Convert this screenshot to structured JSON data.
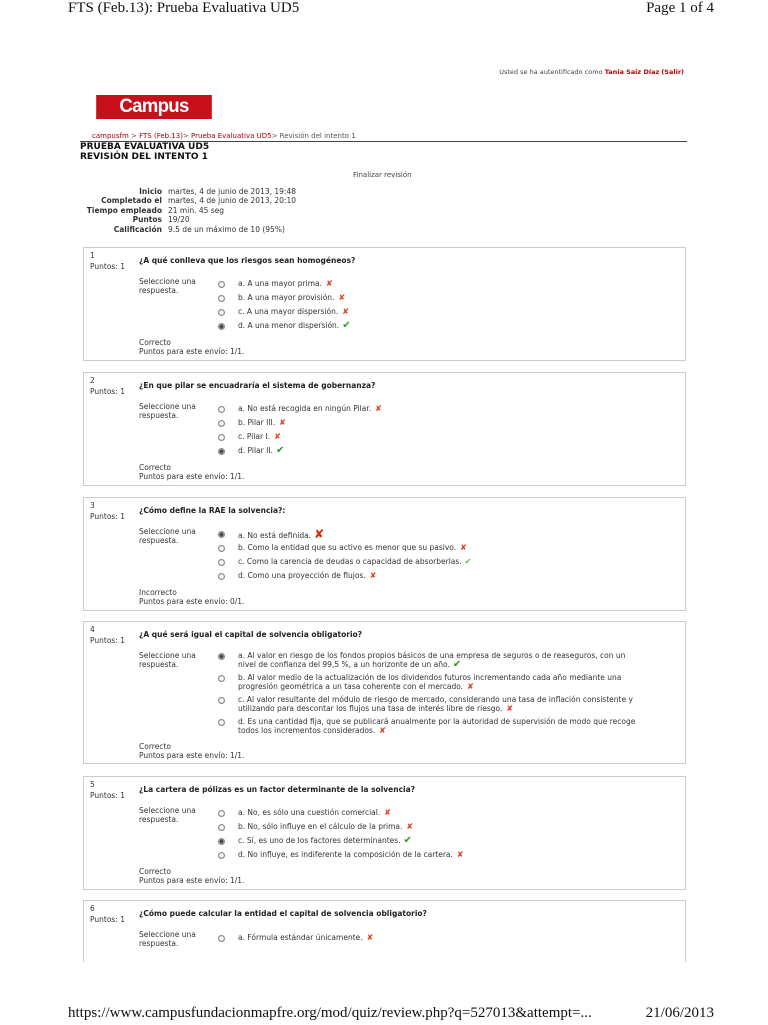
{
  "print": {
    "title": "FTS (Feb.13): Prueba Evaluativa UD5",
    "page": "Page 1 of 4",
    "url": "https://www.campusfundacionmapfre.org/mod/quiz/review.php?q=527013&attempt=...",
    "date": "21/06/2013"
  },
  "auth": {
    "prefix": "Usted se ha autentificado como",
    "user": "Tania Saiz Díaz",
    "logout": "(Salir)"
  },
  "logo": "Campus virtual",
  "breadcrumb": {
    "home": "campusfm",
    "course": "FTS (Feb.13)",
    "quiz": "Prueba Evaluativa UD5",
    "current": "Revisión del intento 1"
  },
  "header": {
    "title": "PRUEBA EVALUATIVA UD5",
    "subtitle": "REVISIÓN DEL INTENTO 1",
    "finish": "Finalizar revisión"
  },
  "summary": [
    {
      "k": "Inicio",
      "v": "martes, 4 de junio de 2013, 19:48"
    },
    {
      "k": "Completado el",
      "v": "martes, 4 de junio de 2013, 20:10"
    },
    {
      "k": "Tiempo empleado",
      "v": "21 min. 45 seg"
    },
    {
      "k": "Puntos",
      "v": "19/20"
    },
    {
      "k": "Calificación",
      "v": "9.5 de un máximo de 10 (95%)"
    }
  ],
  "questions": [
    {
      "num": "1",
      "pts": "Puntos: 1",
      "text": "¿A qué conlleva que los riesgos sean homogéneos?",
      "prompt": "Seleccione una respuesta.",
      "answers": [
        "a. A una mayor prima.",
        "b. A una mayor provisión.",
        "c. A una mayor dispersión.",
        "d. A una menor dispersión."
      ],
      "status": "Correcto",
      "score": "Puntos para este envío: 1/1."
    },
    {
      "num": "2",
      "pts": "Puntos: 1",
      "text": "¿En que pilar se encuadraría el sistema de gobernanza?",
      "prompt": "Seleccione una respuesta.",
      "answers": [
        "a. No está recogida en ningún Pilar.",
        "b. Pilar III.",
        "c. Pilar I.",
        "d. Pilar II."
      ],
      "status": "Correcto",
      "score": "Puntos para este envío: 1/1."
    },
    {
      "num": "3",
      "pts": "Puntos: 1",
      "text": "¿Cómo define la RAE la solvencia?:",
      "prompt": "Seleccione una respuesta.",
      "answers": [
        "a. No está definida.",
        "b. Como la entidad que su activo es menor que su pasivo.",
        "c. Como la carencia de deudas o capacidad de absorberlas.",
        "d. Como una proyección de flujos."
      ],
      "status": "Incorrecto",
      "score": "Puntos para este envío: 0/1."
    },
    {
      "num": "4",
      "pts": "Puntos: 1",
      "text": "¿A qué será igual el capital de solvencia obligatorio?",
      "prompt": "Seleccione una respuesta.",
      "answers": [
        "a. Al valor en riesgo de los fondos propios básicos de una empresa de seguros o de reaseguros, con un nivel de confianza del 99,5 %, a un horizonte de un año.",
        "b. Al valor medio de la actualización de los dividendos futuros incrementando cada año mediante una progresión geométrica a un tasa coherente con el mercado.",
        "c. Al valor resultante del módulo de riesgo de mercado, considerando una tasa de inflación consistente y utilizando para descontar los flujos una tasa de interés libre de riesgo.",
        "d. Es una cantidad fija, que se publicará anualmente por la autoridad de supervisión de modo que recoge todos los incrementos considerados."
      ],
      "status": "Correcto",
      "score": "Puntos para este envío: 1/1."
    },
    {
      "num": "5",
      "pts": "Puntos: 1",
      "text": "¿La cartera de pólizas es un factor determinante de la solvencia?",
      "prompt": "Seleccione una respuesta.",
      "answers": [
        "a. No, es sólo una cuestión comercial.",
        "b. No, sólo influye en el cálculo de la prima.",
        "c. Sí, es uno de los factores determinantes.",
        "d. No influye, es indiferente la composición de la cartera."
      ],
      "status": "Correcto",
      "score": "Puntos para este envío: 1/1."
    },
    {
      "num": "6",
      "pts": "Puntos: 1",
      "text": "¿Cómo puede calcular la entidad el capital de solvencia obligatorio?",
      "prompt": "Seleccione una respuesta.",
      "answers": [
        "a. Fórmula estándar únicamente."
      ]
    }
  ],
  "marks": {
    "wrong": "✘",
    "right": "✔"
  },
  "colors": {
    "brand": "#c8101b",
    "correct": "#2a9a2a",
    "incorrect": "#e04020"
  }
}
